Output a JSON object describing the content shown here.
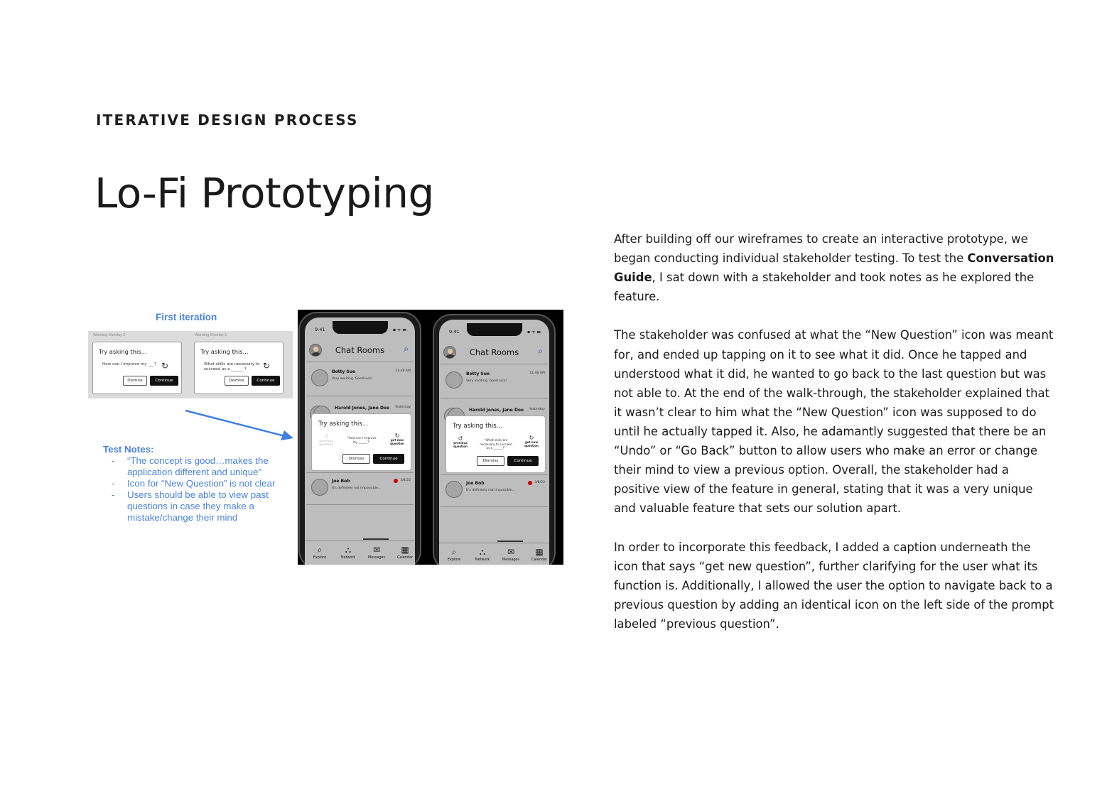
{
  "header": {
    "eyebrow": "ITERATIVE DESIGN PROCESS",
    "title": "Lo-Fi Prototyping"
  },
  "body": {
    "p1_a": "After building off our wireframes to create an interactive prototype, we began conducting individual stakeholder testing. To test the ",
    "p1_bold": "Conversation Guide",
    "p1_b": ", I sat down with a stakeholder and took notes as he explored the feature.",
    "p2": "The stakeholder was confused at what the “New Question” icon was meant for, and ended up tapping on it to see what it did. Once he tapped and understood what it did, he wanted to go back to the last question but was not able to. At the end of the walk-through, the stakeholder explained that it wasn’t clear to him what the “New Question” icon was supposed to do until he actually tapped it. Also, he adamantly suggested that there be an “Undo” or “Go Back” button to allow users who make an error or change their mind to view a previous option. Overall, the stakeholder had a positive view of the feature in general, stating that it was a very unique and valuable feature that sets our solution apart.",
    "p3": "In order to incorporate this feedback, I added a caption underneath the icon that says “get new question”, further clarifying for the user what its function is. Additionally, I allowed the user the option to navigate back to a previous question by adding an identical icon on the left side of the prompt labeled “previous question”."
  },
  "first_iteration": {
    "label": "First iteration",
    "overlays": [
      {
        "tag": "Warning Overlay 2",
        "title": "Try asking this...",
        "question": "How can I improve my ___?",
        "dismiss": "Dismiss",
        "continue": "Continue"
      },
      {
        "tag": "Warning Overlay 1",
        "title": "Try asking this...",
        "question": "What skills are necessary to succeed as a ______ ?",
        "dismiss": "Dismiss",
        "continue": "Continue"
      }
    ]
  },
  "test_notes": {
    "heading": "Test Notes:",
    "items": [
      "“The concept is good…makes the application different and unique”",
      "Icon for “New Question” is not clear",
      "Users should be able to view past questions in case they make a mistake/change their mind"
    ]
  },
  "phones": [
    {
      "time": "9:41",
      "status": "▪ ᯤ ▬",
      "title": "Chat Rooms",
      "chats": [
        {
          "name": "Betty Sue",
          "preview": "Very exciting. Good luck!",
          "time": "11:48 AM"
        },
        {
          "name": "Harold Jones, Jane Doe",
          "preview": "",
          "time": "Yesterday"
        },
        {
          "name": "Joe Bob",
          "preview": "It's definitely not impossible...",
          "time": "3/8/22"
        }
      ],
      "popup": {
        "title": "Try asking this...",
        "question": "“How can I improve my ______?”",
        "prev_label": "previous question",
        "next_label": "get new question",
        "dismiss": "Dismiss",
        "continue": "Continue"
      },
      "tabs": [
        "Explore",
        "Network",
        "Messages",
        "Calendar"
      ]
    },
    {
      "time": "9:41",
      "status": "▪ ᯤ ▬",
      "title": "Chat Rooms",
      "chats": [
        {
          "name": "Betty Sue",
          "preview": "Very exciting. Good luck!",
          "time": "11:48 AM"
        },
        {
          "name": "Harold Jones, Jane Doe",
          "preview": "",
          "time": "Yesterday"
        },
        {
          "name": "Joe Bob",
          "preview": "It's definitely not impossible...",
          "time": "3/8/22"
        }
      ],
      "popup": {
        "title": "Try asking this...",
        "question": "“What skills are necessary to succeed as a ______?”",
        "prev_label": "previous question",
        "next_label": "get new question",
        "dismiss": "Dismiss",
        "continue": "Continue"
      },
      "tabs": [
        "Explore",
        "Network",
        "Messages",
        "Calendar"
      ]
    }
  ],
  "colors": {
    "note_blue": "#4a84dc",
    "arrow_blue": "#3f7fe0"
  }
}
